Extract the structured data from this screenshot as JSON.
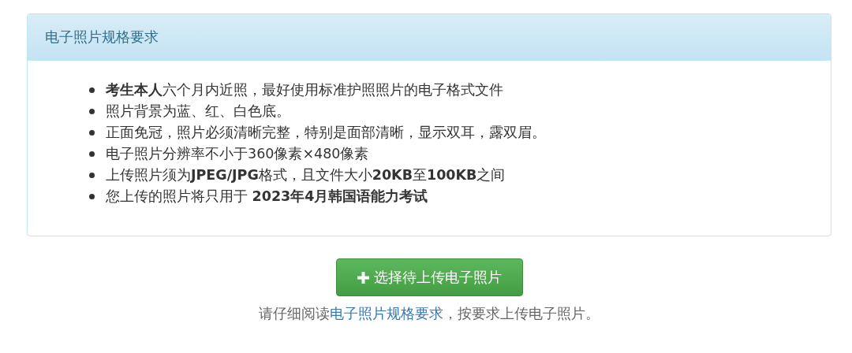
{
  "panel": {
    "title": "电子照片规格要求",
    "items": [
      "**考生本人**六个月内近照，最好使用标准护照照片的电子格式文件",
      "照片背景为蓝、红、白色底。",
      "正面免冠，照片必须清晰完整，特别是面部清晰，显示双耳，露双眉。",
      "电子照片分辨率不小于360像素×480像素",
      "上传照片须为**JPEG/JPG**格式，且文件大小**20KB**至**100KB**之间",
      "您上传的照片将只用于  **2023年4月韩国语能力考试**"
    ]
  },
  "upload_button": {
    "label": "选择待上传电子照片"
  },
  "hint": {
    "before": "请仔细阅读",
    "link": "电子照片规格要求",
    "after": "，按要求上传电子照片。"
  }
}
